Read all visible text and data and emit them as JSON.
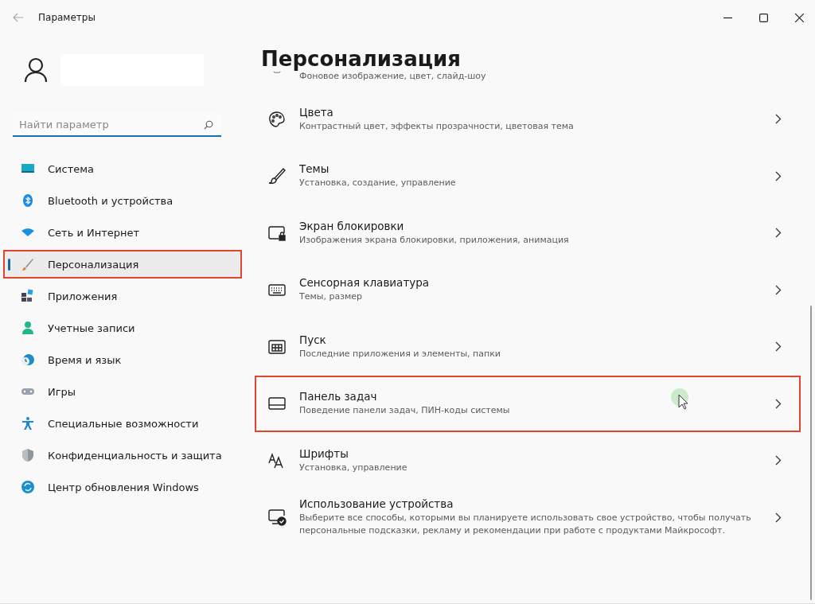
{
  "window": {
    "title": "Параметры"
  },
  "search": {
    "placeholder": "Найти параметр"
  },
  "sidebar": {
    "items": [
      {
        "label": "Система",
        "selected": false,
        "highlighted": false
      },
      {
        "label": "Bluetooth и устройства",
        "selected": false,
        "highlighted": false
      },
      {
        "label": "Сеть и Интернет",
        "selected": false,
        "highlighted": false
      },
      {
        "label": "Персонализация",
        "selected": true,
        "highlighted": true
      },
      {
        "label": "Приложения",
        "selected": false,
        "highlighted": false
      },
      {
        "label": "Учетные записи",
        "selected": false,
        "highlighted": false
      },
      {
        "label": "Время и язык",
        "selected": false,
        "highlighted": false
      },
      {
        "label": "Игры",
        "selected": false,
        "highlighted": false
      },
      {
        "label": "Специальные возможности",
        "selected": false,
        "highlighted": false
      },
      {
        "label": "Конфиденциальность и защита",
        "selected": false,
        "highlighted": false
      },
      {
        "label": "Центр обновления Windows",
        "selected": false,
        "highlighted": false
      }
    ]
  },
  "page": {
    "title": "Персонализация",
    "items": [
      {
        "subtitle": "Фоновое изображение, цвет, слайд-шоу",
        "highlighted": false
      },
      {
        "title": "Цвета",
        "subtitle": "Контрастный цвет, эффекты прозрачности, цветовая тема",
        "highlighted": false
      },
      {
        "title": "Темы",
        "subtitle": "Установка, создание, управление",
        "highlighted": false
      },
      {
        "title": "Экран блокировки",
        "subtitle": "Изображения экрана блокировки, приложения, анимация",
        "highlighted": false
      },
      {
        "title": "Сенсорная клавиатура",
        "subtitle": "Темы, размер",
        "highlighted": false
      },
      {
        "title": "Пуск",
        "subtitle": "Последние приложения и элементы, папки",
        "highlighted": false
      },
      {
        "title": "Панель задач",
        "subtitle": "Поведение панели задач, ПИН-коды системы",
        "highlighted": true
      },
      {
        "title": "Шрифты",
        "subtitle": "Установка, управление",
        "highlighted": false
      },
      {
        "title": "Использование устройства",
        "subtitle": "Выберите все способы, которыми вы планируете использовать свое устройство, чтобы получать персональные подсказки, рекламу и рекомендации при работе с продуктами Майкрософт.",
        "highlighted": false
      }
    ]
  }
}
